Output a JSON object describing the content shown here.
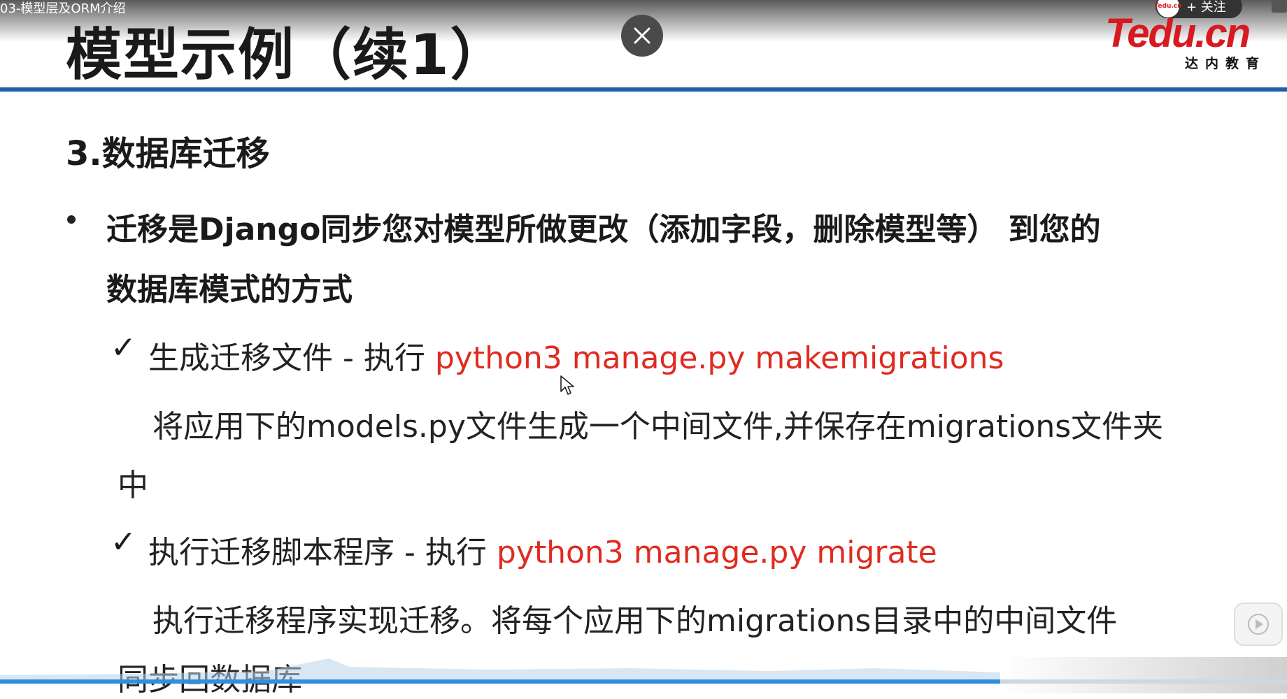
{
  "video": {
    "title": "03-模型层及ORM介绍",
    "follow_label": "+ 关注",
    "progress_fraction": 0.777,
    "avatar_text": "Tedu.cn"
  },
  "slide": {
    "title": "模型示例（续1）",
    "logo_main": "Tedu.cn",
    "logo_sub": "达内教育",
    "section_heading": "3.数据库迁移",
    "bullet_line1": "迁移是Django同步您对模型所做更改（添加字段，删除模型等） 到您的",
    "bullet_line2": "数据库模式的方式",
    "items": [
      {
        "check": "✓",
        "text": "生成迁移文件 - 执行 ",
        "command": "python3 manage.py makemigrations",
        "desc_line1": "将应用下的models.py文件生成一个中间文件,并保存在migrations文件夹",
        "desc_line2": "中"
      },
      {
        "check": "✓",
        "text": "执行迁移脚本程序 - 执行 ",
        "command": "python3 manage.py migrate",
        "desc_line1": "执行迁移程序实现迁移。将每个应用下的migrations目录中的中间文件",
        "desc_line2": "同步回数据库"
      }
    ]
  },
  "colors": {
    "accent_rule": "#1f5fa8",
    "command_red": "#e02b20",
    "logo_red": "#d71920",
    "progress_blue": "#2f8fdc"
  },
  "icons": {
    "close": "close-icon",
    "play": "play-icon",
    "cursor": "mouse-pointer-icon"
  }
}
